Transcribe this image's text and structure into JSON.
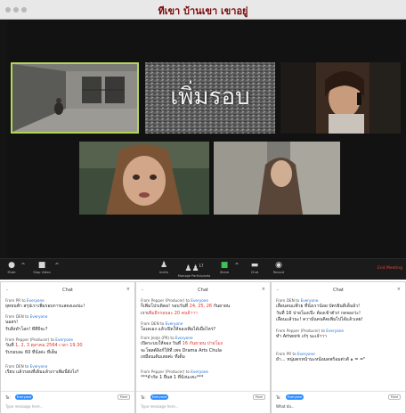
{
  "window": {
    "title": "ทีเขา บ้านเขา เขาอยู่"
  },
  "stage": {
    "banner_text": "เพิ่มรอบ"
  },
  "toolbar": {
    "buttons": [
      {
        "name": "mute",
        "label": "Mute",
        "icon": "microphone-icon"
      },
      {
        "name": "stop-video",
        "label": "Stop Video",
        "icon": "video-camera-icon"
      },
      {
        "name": "invite",
        "label": "Invite",
        "icon": "invite-icon"
      },
      {
        "name": "manage-participants",
        "label": "Manage Participants",
        "icon": "participants-icon",
        "count": "17"
      },
      {
        "name": "share",
        "label": "Share",
        "icon": "share-screen-icon"
      },
      {
        "name": "chat",
        "label": "Chat",
        "icon": "chat-icon"
      },
      {
        "name": "record",
        "label": "Record",
        "icon": "record-icon"
      }
    ],
    "end_label": "End Meeting"
  },
  "chat": {
    "title": "Chat",
    "to_label": "To:",
    "to_value": "Everyone",
    "more_label": "More",
    "placeholder": "Type message here...",
    "panel3_typed": "What da...",
    "panels": [
      {
        "messages": [
          {
            "from": "From PR to",
            "to": "Everyone",
            "lines": [
              [
                {
                  "t": "ยุทธนพ้า สรุปเราเพิ่มรอบการแสดงเองน่ะ!"
                }
              ]
            ]
          },
          {
            "from": "From DEN to",
            "to": "Everyone",
            "lines": [
              [
                {
                  "t": "นอสร!"
                }
              ],
              [
                {
                  "t": "รับสิ่งทำโลก! ทีสีจีจะ?"
                }
              ]
            ]
          },
          {
            "from": "From Pepper (Producer) to",
            "to": "Everyone",
            "lines": [
              [
                {
                  "t": "วันที่ "
                },
                {
                  "t": "1, 2, 3 ตุลาคม 2564 เวลา 19.30",
                  "r": true
                }
              ],
              [
                {
                  "t": "รับรอบละ 60 ที่นั่งค่ะ ที่เต็ม"
                }
              ]
            ]
          },
          {
            "from": "From DEN to",
            "to": "Everyone",
            "lines": [
              [
                {
                  "t": "เรียบ แล้วรอบที่เดิมแล้วเราเพิ่มนี่ยังไง?"
                }
              ]
            ]
          }
        ]
      },
      {
        "messages": [
          {
            "from": "From Pepper (Producer) to",
            "to": "Everyone",
            "lines": [
              [
                {
                  "t": "ก็เพิ่มโปรเดิดอ! รอบวันที่ "
                },
                {
                  "t": "24, 25, 26",
                  "r": true
                },
                {
                  "t": " กันยายน"
                }
              ],
              [
                {
                  "t": "เราเ"
                },
                {
                  "t": "พิ่มอีกรอบละ 20 คนจ้าาา",
                  "r": true
                }
              ]
            ]
          },
          {
            "from": "From DEN to",
            "to": "Everyone",
            "lines": [
              [
                {
                  "t": "โอเคเอง แล้วเปิดให้จองเพิ่มได้เมื่อไหร่?"
                }
              ]
            ]
          },
          {
            "from": "From JenJe (PR) to",
            "to": "Everyone",
            "lines": [
              [
                {
                  "t": "เปิดระบบให้จอง วันที่ "
                },
                {
                  "t": "16 กันยายน ปายโมง",
                  "r": true
                }
              ],
              [
                {
                  "t": "จะโพสต์ลิงก์ให้ที่ เพจ Drama Arts Chula"
                }
              ],
              [
                {
                  "t": "เหมือนเดิมเลยค่ะ ที่เต็ม"
                }
              ]
            ]
          },
          {
            "from": "From Pepper (Producer) to",
            "to": "Everyone",
            "lines": [
              [
                {
                  "t": "***จำกัด 1 ยืนส 1 ที่นั่งนะคะ***"
                }
              ]
            ]
          }
        ]
      },
      {
        "messages": [
          {
            "from": "From DEN to",
            "to": "Everyone",
            "lines": [
              [
                {
                  "t": "เลื่อนคนแฟ้วย ที่นั่งเราน้อย บัตรยินดีเต็มอ้ว!"
                }
              ],
              [
                {
                  "t": "วันที่ 16 ปายโมงเป๊ะ ต้องเข้าตัวก่ กดจองว่ะ!"
                }
              ],
              [
                {
                  "t": "เลื่อนแล้วนะ! ความั่นคนคิดเพิ่มไปได้แล้วเลย!"
                }
              ]
            ]
          },
          {
            "from": "From Pepper (Producer) to",
            "to": "Everyone",
            "lines": [
              [
                {
                  "t": "ทำ Artwork เก๋ๆ นะเจ้าาา"
                }
              ]
            ]
          },
          {
            "from": "From PR to",
            "to": "Everyone",
            "lines": [
              [
                {
                  "t": "ยำ... หนุ่มตกหน้านะหน้อมดพร้อมต่วตั ๑ = =\""
                }
              ]
            ]
          }
        ]
      }
    ]
  }
}
